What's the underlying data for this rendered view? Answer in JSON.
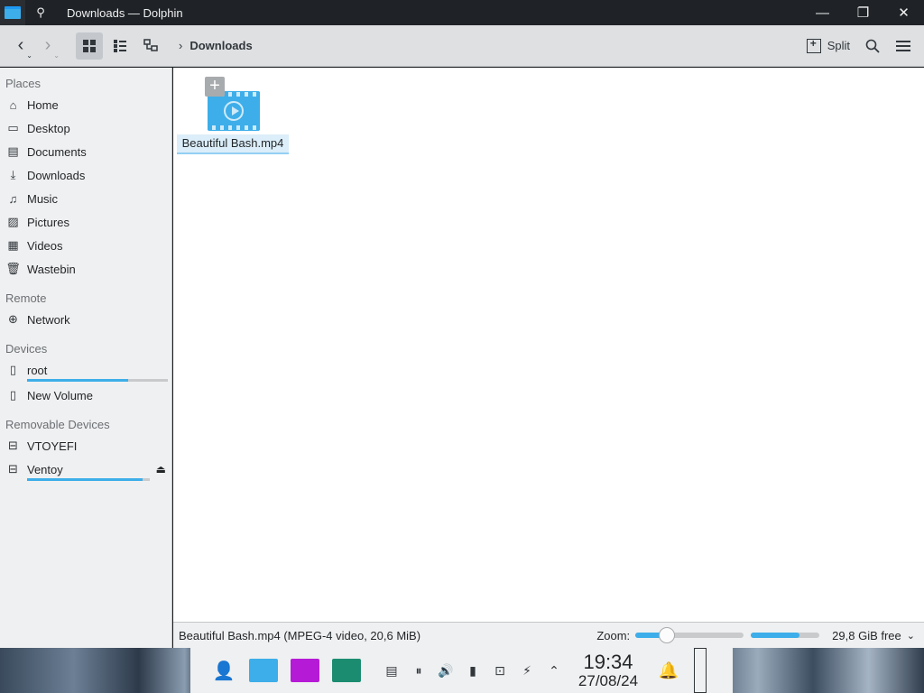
{
  "window": {
    "title": "Downloads — Dolphin",
    "pin_glyph": "⚲",
    "minimize_glyph": "—",
    "restore_glyph": "❐",
    "close_glyph": "✕"
  },
  "toolbar": {
    "back_glyph": "‹",
    "forward_glyph": "›",
    "dropdown_glyph": "⌄",
    "breadcrumb_sep": "›",
    "breadcrumb": [
      "Downloads"
    ],
    "split_label": "Split",
    "search_glyph": "⚲",
    "menu_glyph": "☰",
    "active_view": "icons"
  },
  "sidebar": {
    "places_title": "Places",
    "places": [
      {
        "label": "Home",
        "icon": "home-icon",
        "glyph": "⌂"
      },
      {
        "label": "Desktop",
        "icon": "desktop-icon",
        "glyph": "▭"
      },
      {
        "label": "Documents",
        "icon": "documents-icon",
        "glyph": "▤"
      },
      {
        "label": "Downloads",
        "icon": "downloads-icon",
        "glyph": "⤓"
      },
      {
        "label": "Music",
        "icon": "music-icon",
        "glyph": "♫"
      },
      {
        "label": "Pictures",
        "icon": "pictures-icon",
        "glyph": "▨"
      },
      {
        "label": "Videos",
        "icon": "videos-icon",
        "glyph": "▦"
      },
      {
        "label": "Wastebin",
        "icon": "wastebin-icon",
        "glyph": "🗑"
      }
    ],
    "remote_title": "Remote",
    "remote": [
      {
        "label": "Network",
        "icon": "network-icon",
        "glyph": "⊕"
      }
    ],
    "devices_title": "Devices",
    "devices": [
      {
        "label": "root",
        "icon": "drive-icon",
        "glyph": "▯",
        "usage": 0.72
      },
      {
        "label": "New Volume",
        "icon": "drive-warning-icon",
        "glyph": "▯"
      }
    ],
    "removable_title": "Removable Devices",
    "removable": [
      {
        "label": "VTOYEFI",
        "icon": "usb-warning-icon",
        "glyph": "⊟"
      },
      {
        "label": "Ventoy",
        "icon": "usb-icon",
        "glyph": "⊟",
        "usage": 0.94,
        "eject_glyph": "⏏"
      }
    ]
  },
  "files": [
    {
      "name": "Beautiful Bash.mp4",
      "icon": "video-file-icon",
      "selected": true
    }
  ],
  "statusbar": {
    "info": "Beautiful Bash.mp4 (MPEG-4 video, 20,6 MiB)",
    "zoom_label": "Zoom:",
    "zoom_level": 0.29,
    "space_used": 0.71,
    "free_text": "29,8 GiB free",
    "chevron_glyph": "⌄"
  },
  "panel": {
    "time": "19:34",
    "date": "27/08/24",
    "launcher_glyph": "👤",
    "tray_glyphs": [
      "▤",
      "⏸",
      "🔊",
      "▮",
      "⊡",
      "⚡",
      "⌃"
    ],
    "bell_glyph": "🔔",
    "colors": {
      "dolphin": "#3daee9",
      "terminal": "#b51ad6",
      "monitor": "#1c8c70"
    }
  }
}
